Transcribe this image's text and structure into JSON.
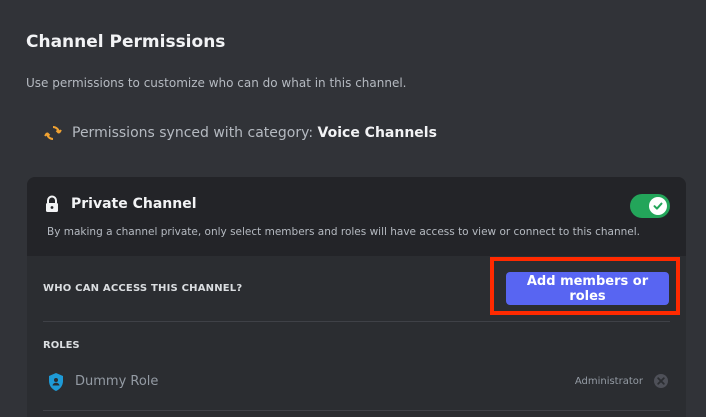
{
  "header": {
    "title": "Channel Permissions",
    "subtitle": "Use permissions to customize who can do what in this channel."
  },
  "sync": {
    "icon": "sync-icon",
    "text": "Permissions synced with category: ",
    "category": "Voice Channels"
  },
  "private_channel": {
    "icon": "lock-icon",
    "label": "Private Channel",
    "description": "By making a channel private, only select members and roles will have access to view or connect to this channel.",
    "enabled": true
  },
  "access": {
    "label": "WHO CAN ACCESS THIS CHANNEL?",
    "add_button_label": "Add members or roles"
  },
  "roles": {
    "label": "ROLES",
    "items": [
      {
        "name": "Dummy Role",
        "permission": "Administrator",
        "icon": "role-shield-icon"
      }
    ]
  },
  "colors": {
    "background": "#313338",
    "accent": "#5865f2",
    "toggle_on": "#23a55a",
    "highlight": "#ff2a00",
    "sync_icon": "#f0a232",
    "role_icon": "#1e9ad6"
  }
}
